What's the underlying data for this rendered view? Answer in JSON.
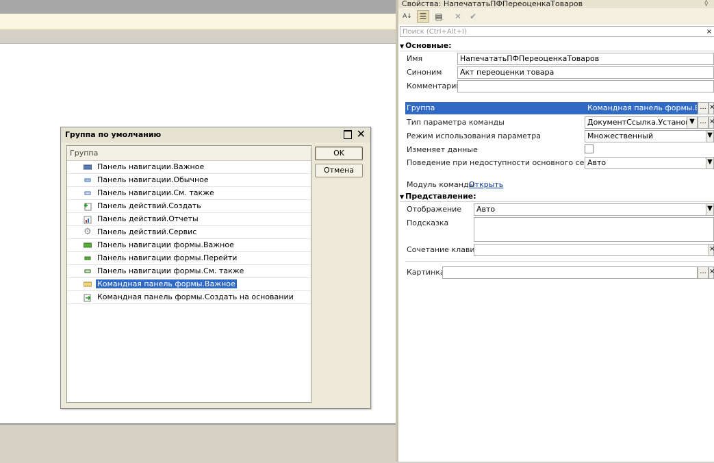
{
  "properties_window": {
    "title": "Свойства: НапечататьПФПереоценкаТоваров",
    "search_placeholder": "Поиск (Ctrl+Alt+I)",
    "sections": {
      "main": "Основные:",
      "view": "Представление:"
    },
    "fields": {
      "name_label": "Имя",
      "name_value": "НапечататьПФПереоценкаТоваров",
      "synonym_label": "Синоним",
      "synonym_value": "Акт переоценки товара",
      "comment_label": "Комментарий",
      "comment_value": "",
      "group_label": "Группа",
      "group_value": "Командная панель формы.Важное",
      "param_type_label": "Тип параметра команды",
      "param_type_value": "ДокументСсылка.УстановкаЦен",
      "param_mode_label": "Режим использования параметра",
      "param_mode_value": "Множественный",
      "modifies_data_label": "Изменяет данные",
      "server_behavior_label": "Поведение при недоступности основного сервера",
      "server_behavior_value": "Авто",
      "command_module_label": "Модуль команды",
      "command_module_link": "Открыть",
      "display_label": "Отображение",
      "display_value": "Авто",
      "tooltip_label": "Подсказка",
      "tooltip_value": "",
      "shortcut_label": "Сочетание клавиш",
      "shortcut_value": "",
      "picture_label": "Картинка",
      "picture_value": ""
    },
    "button_ellipsis": "...",
    "button_clear": "×"
  },
  "dialog": {
    "title": "Группа по умолчанию",
    "column_header": "Группа",
    "ok_label": "OK",
    "cancel_label": "Отмена",
    "selected_index": 9,
    "items": [
      {
        "label": "Панель навигации.Важное",
        "icon": "nav-important-icon"
      },
      {
        "label": "Панель навигации.Обычное",
        "icon": "nav-normal-icon"
      },
      {
        "label": "Панель навигации.См. также",
        "icon": "nav-seealso-icon"
      },
      {
        "label": "Панель действий.Создать",
        "icon": "create-icon"
      },
      {
        "label": "Панель действий.Отчеты",
        "icon": "reports-icon"
      },
      {
        "label": "Панель действий.Сервис",
        "icon": "gear-icon"
      },
      {
        "label": "Панель навигации формы.Важное",
        "icon": "form-nav-important-icon"
      },
      {
        "label": "Панель навигации формы.Перейти",
        "icon": "form-nav-goto-icon"
      },
      {
        "label": "Панель навигации формы.См. также",
        "icon": "form-nav-seealso-icon"
      },
      {
        "label": "Командная панель формы.Важное",
        "icon": "command-panel-icon"
      },
      {
        "label": "Командная панель формы.Создать на основании",
        "icon": "create-based-on-icon"
      }
    ]
  },
  "colors": {
    "selection": "#316ac5",
    "link": "#0b3aa0"
  }
}
